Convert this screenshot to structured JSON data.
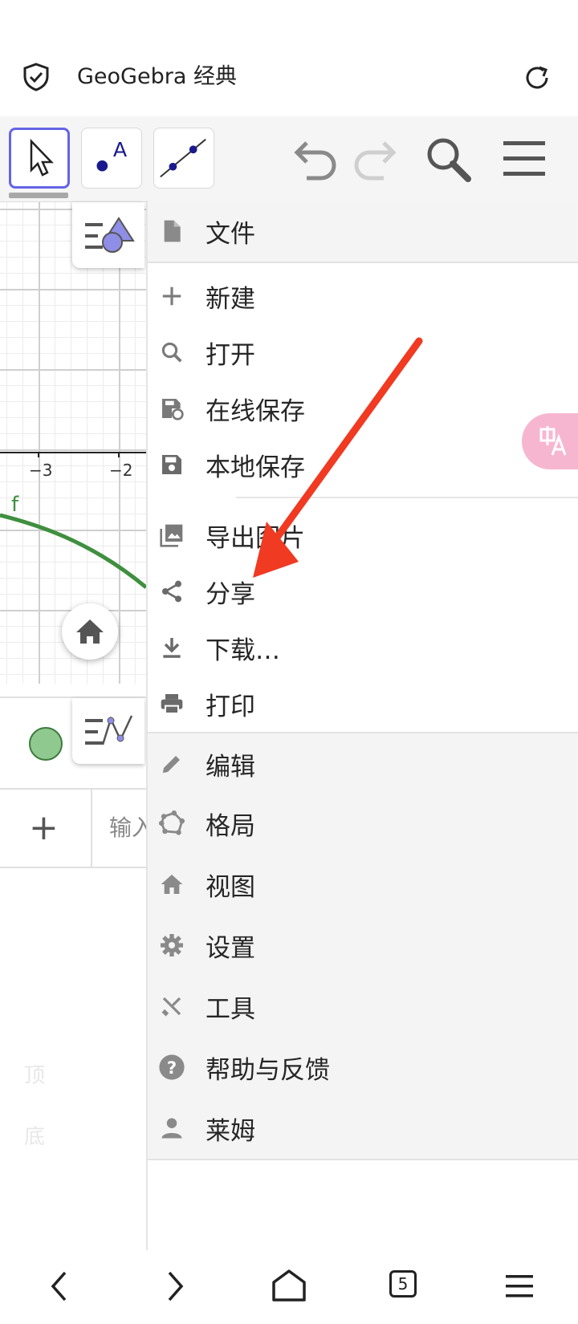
{
  "browser": {
    "title": "GeoGebra 经典"
  },
  "graphics": {
    "x_tick_labels": [
      "−3",
      "−2"
    ],
    "function_label": "f",
    "function_color": "#3f8f3f"
  },
  "algebra": {
    "input_placeholder": "输入",
    "add_label": "+",
    "faint_top": "顶",
    "faint_bottom": "底"
  },
  "menu": {
    "file": "文件",
    "new": "新建",
    "open": "打开",
    "save_online": "在线保存",
    "save_local": "本地保存",
    "export_image": "导出图片",
    "share": "分享",
    "download": "下载…",
    "print": "打印",
    "edit": "编辑",
    "layout": "格局",
    "view": "视图",
    "settings": "设置",
    "tools": "工具",
    "help": "帮助与反馈",
    "user": "莱姆"
  },
  "bottom_nav": {
    "tab_count": "5"
  },
  "colors": {
    "accent": "#6464e6",
    "arrow": "#f03a22",
    "menu_header_bg": "#f4f4f4"
  }
}
